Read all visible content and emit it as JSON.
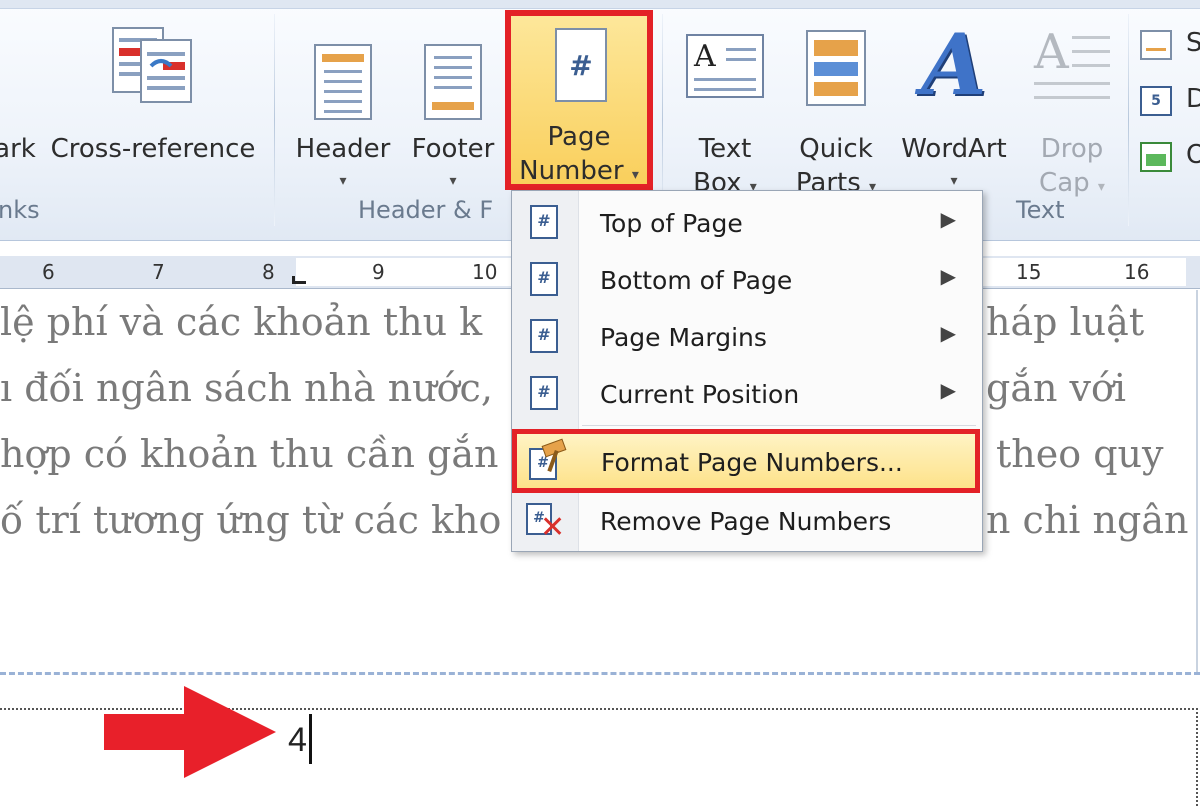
{
  "ribbon": {
    "buttons": {
      "bookmark": "ark",
      "cross_reference": "Cross-reference",
      "header": "Header",
      "footer": "Footer",
      "page_number_1": "Page",
      "page_number_2": "Number",
      "text_box_1": "Text",
      "text_box_2": "Box",
      "quick_parts_1": "Quick",
      "quick_parts_2": "Parts",
      "wordart": "WordArt",
      "drop_cap_1": "Drop",
      "drop_cap_2": "Cap",
      "right_cut_1": "S",
      "right_cut_2": "D",
      "right_cut_3": "O"
    },
    "groups": {
      "links": "nks",
      "header_footer": "Header & F",
      "text": "Text"
    },
    "caret": "▾"
  },
  "ruler": {
    "labels": [
      "6",
      "7",
      "8",
      "9",
      "10",
      "15",
      "16"
    ]
  },
  "document": {
    "lines": [
      "lệ phí và các khoản thu k",
      "ı đối ngân sách nhà nước,",
      "hợp có khoản thu cần gắn",
      "ố trí tương ứng từ các kho"
    ],
    "lines_right": [
      "háp luật",
      "gắn với",
      "theo quy",
      "n chi ngân"
    ],
    "page_number": "4"
  },
  "menu": {
    "items": [
      {
        "label": "Top of Page",
        "submenu": true
      },
      {
        "label": "Bottom of Page",
        "submenu": true
      },
      {
        "label": "Page Margins",
        "submenu": true
      },
      {
        "label": "Current Position",
        "submenu": true
      },
      {
        "label": "Format Page Numbers...",
        "submenu": false
      },
      {
        "label": "Remove Page Numbers",
        "submenu": false
      }
    ],
    "arrow": "▶"
  },
  "colors": {
    "highlight_border": "#e32127",
    "arrow": "#e8202a"
  }
}
